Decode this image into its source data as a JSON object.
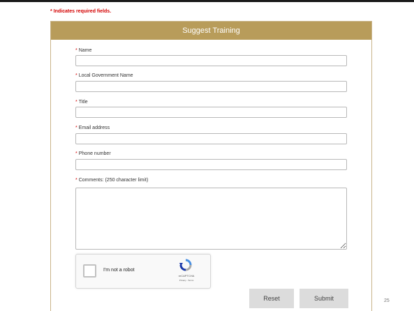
{
  "required_note": "* Indicates required fields.",
  "form": {
    "title": "Suggest Training",
    "fields": [
      {
        "label": "Name",
        "required_mark": "*",
        "value": ""
      },
      {
        "label": "Local Government Name",
        "required_mark": "*",
        "value": ""
      },
      {
        "label": "Title",
        "required_mark": "*",
        "value": ""
      },
      {
        "label": "Email address",
        "required_mark": "*",
        "value": ""
      },
      {
        "label": "Phone number",
        "required_mark": "*",
        "value": ""
      }
    ],
    "comments": {
      "label": "Comments: (250 character limit)",
      "required_mark": "*",
      "value": ""
    }
  },
  "captcha": {
    "label": "I'm not a robot",
    "brand": "reCAPTCHA",
    "links": "Privacy - Terms",
    "checked": false
  },
  "buttons": {
    "reset": "Reset",
    "submit": "Submit"
  },
  "page_number": "25",
  "colors": {
    "header": "#b89c5a",
    "required": "#d40000",
    "button": "#dcdcdc"
  }
}
